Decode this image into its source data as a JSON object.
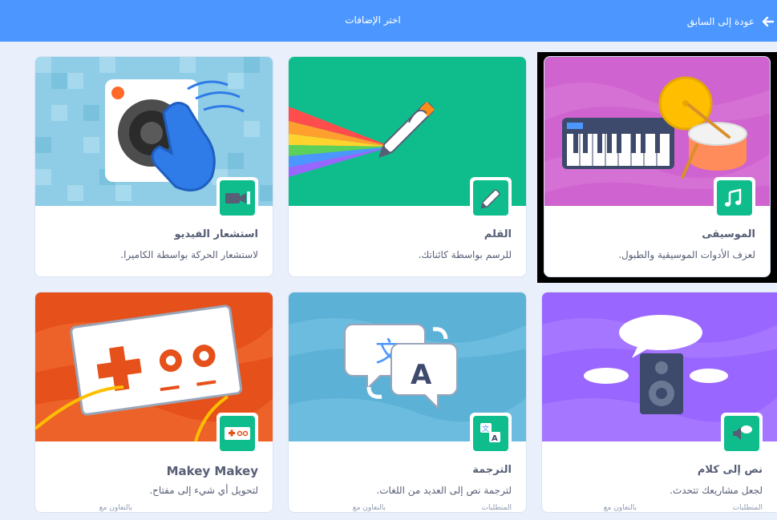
{
  "header": {
    "title": "اختر الإضافات",
    "back_label": "عودة إلى السابق"
  },
  "cards": [
    {
      "name": "استشعار الفيديو",
      "desc": "لاستشعار الحركة بواسطة الكاميرا."
    },
    {
      "name": "القلم",
      "desc": "للرسم بواسطة كائناتك."
    },
    {
      "name": "الموسيقى",
      "desc": "لعزف الأدوات الموسيقية والطبول."
    },
    {
      "name": "Makey Makey",
      "desc": "لتحويل أي شيء إلى مفتاح.",
      "collab": "بالتعاون مع"
    },
    {
      "name": "الترجمة",
      "desc": "لترجمة نص إلى العديد من اللغات.",
      "collab": "بالتعاون مع",
      "req": "المتطلبات"
    },
    {
      "name": "نص إلى كلام",
      "desc": "لجعل مشاريعك تتحدث.",
      "collab": "بالتعاون مع",
      "req": "المتطلبات"
    }
  ],
  "colors": {
    "header": "#4c97ff",
    "badge": "#0fbd8c",
    "selection": "#000000"
  },
  "icons": [
    "back-arrow-icon",
    "video-camera-icon",
    "pen-icon",
    "music-notes-icon",
    "makey-board-icon",
    "translate-icon",
    "speech-bubble-icon"
  ]
}
